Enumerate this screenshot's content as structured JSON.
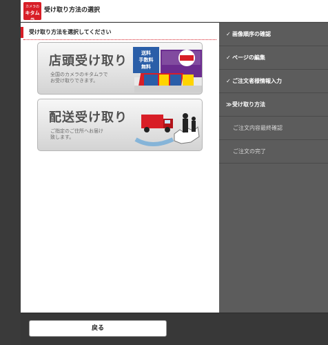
{
  "header": {
    "logo_line1": "カメラの",
    "logo_line2": "キタムラ",
    "title": "受け取り方法の選択"
  },
  "main": {
    "section_title": "受け取り方法を選択してください",
    "options": [
      {
        "title": "店頭受け取り",
        "description": "全国のカメラのキタムラで\nお受け取りできます。",
        "badge": "送料\n手数料\n無料"
      },
      {
        "title": "配送受け取り",
        "description": "ご指定のご住所へお届け\n致します。"
      }
    ]
  },
  "sidebar": {
    "steps": [
      {
        "label": "画像順序の確認",
        "icon": "✓",
        "state": "done"
      },
      {
        "label": "ページの編集",
        "icon": "✓",
        "state": "done"
      },
      {
        "label": "ご注文者様情報入力",
        "icon": "✓",
        "state": "done"
      },
      {
        "label": "受け取り方法",
        "icon": "≫",
        "state": "current"
      },
      {
        "label": "ご注文内容最終確認",
        "icon": "",
        "state": "pending"
      },
      {
        "label": "ご注文の完了",
        "icon": "",
        "state": "pending"
      }
    ]
  },
  "footer": {
    "back_label": "戻る"
  },
  "colors": {
    "brand": "#d81e27",
    "sidebar_bg": "#5c5c5c",
    "page_bg": "#3a3a3a"
  }
}
